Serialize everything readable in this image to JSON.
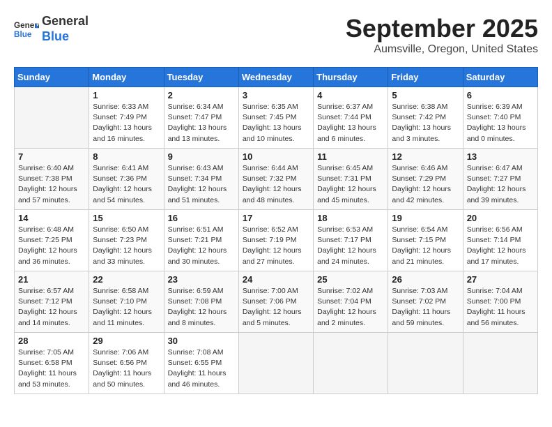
{
  "header": {
    "logo_general": "General",
    "logo_blue": "Blue",
    "month_title": "September 2025",
    "subtitle": "Aumsville, Oregon, United States"
  },
  "weekdays": [
    "Sunday",
    "Monday",
    "Tuesday",
    "Wednesday",
    "Thursday",
    "Friday",
    "Saturday"
  ],
  "weeks": [
    [
      {
        "num": "",
        "info": ""
      },
      {
        "num": "1",
        "info": "Sunrise: 6:33 AM\nSunset: 7:49 PM\nDaylight: 13 hours\nand 16 minutes."
      },
      {
        "num": "2",
        "info": "Sunrise: 6:34 AM\nSunset: 7:47 PM\nDaylight: 13 hours\nand 13 minutes."
      },
      {
        "num": "3",
        "info": "Sunrise: 6:35 AM\nSunset: 7:45 PM\nDaylight: 13 hours\nand 10 minutes."
      },
      {
        "num": "4",
        "info": "Sunrise: 6:37 AM\nSunset: 7:44 PM\nDaylight: 13 hours\nand 6 minutes."
      },
      {
        "num": "5",
        "info": "Sunrise: 6:38 AM\nSunset: 7:42 PM\nDaylight: 13 hours\nand 3 minutes."
      },
      {
        "num": "6",
        "info": "Sunrise: 6:39 AM\nSunset: 7:40 PM\nDaylight: 13 hours\nand 0 minutes."
      }
    ],
    [
      {
        "num": "7",
        "info": "Sunrise: 6:40 AM\nSunset: 7:38 PM\nDaylight: 12 hours\nand 57 minutes."
      },
      {
        "num": "8",
        "info": "Sunrise: 6:41 AM\nSunset: 7:36 PM\nDaylight: 12 hours\nand 54 minutes."
      },
      {
        "num": "9",
        "info": "Sunrise: 6:43 AM\nSunset: 7:34 PM\nDaylight: 12 hours\nand 51 minutes."
      },
      {
        "num": "10",
        "info": "Sunrise: 6:44 AM\nSunset: 7:32 PM\nDaylight: 12 hours\nand 48 minutes."
      },
      {
        "num": "11",
        "info": "Sunrise: 6:45 AM\nSunset: 7:31 PM\nDaylight: 12 hours\nand 45 minutes."
      },
      {
        "num": "12",
        "info": "Sunrise: 6:46 AM\nSunset: 7:29 PM\nDaylight: 12 hours\nand 42 minutes."
      },
      {
        "num": "13",
        "info": "Sunrise: 6:47 AM\nSunset: 7:27 PM\nDaylight: 12 hours\nand 39 minutes."
      }
    ],
    [
      {
        "num": "14",
        "info": "Sunrise: 6:48 AM\nSunset: 7:25 PM\nDaylight: 12 hours\nand 36 minutes."
      },
      {
        "num": "15",
        "info": "Sunrise: 6:50 AM\nSunset: 7:23 PM\nDaylight: 12 hours\nand 33 minutes."
      },
      {
        "num": "16",
        "info": "Sunrise: 6:51 AM\nSunset: 7:21 PM\nDaylight: 12 hours\nand 30 minutes."
      },
      {
        "num": "17",
        "info": "Sunrise: 6:52 AM\nSunset: 7:19 PM\nDaylight: 12 hours\nand 27 minutes."
      },
      {
        "num": "18",
        "info": "Sunrise: 6:53 AM\nSunset: 7:17 PM\nDaylight: 12 hours\nand 24 minutes."
      },
      {
        "num": "19",
        "info": "Sunrise: 6:54 AM\nSunset: 7:15 PM\nDaylight: 12 hours\nand 21 minutes."
      },
      {
        "num": "20",
        "info": "Sunrise: 6:56 AM\nSunset: 7:14 PM\nDaylight: 12 hours\nand 17 minutes."
      }
    ],
    [
      {
        "num": "21",
        "info": "Sunrise: 6:57 AM\nSunset: 7:12 PM\nDaylight: 12 hours\nand 14 minutes."
      },
      {
        "num": "22",
        "info": "Sunrise: 6:58 AM\nSunset: 7:10 PM\nDaylight: 12 hours\nand 11 minutes."
      },
      {
        "num": "23",
        "info": "Sunrise: 6:59 AM\nSunset: 7:08 PM\nDaylight: 12 hours\nand 8 minutes."
      },
      {
        "num": "24",
        "info": "Sunrise: 7:00 AM\nSunset: 7:06 PM\nDaylight: 12 hours\nand 5 minutes."
      },
      {
        "num": "25",
        "info": "Sunrise: 7:02 AM\nSunset: 7:04 PM\nDaylight: 12 hours\nand 2 minutes."
      },
      {
        "num": "26",
        "info": "Sunrise: 7:03 AM\nSunset: 7:02 PM\nDaylight: 11 hours\nand 59 minutes."
      },
      {
        "num": "27",
        "info": "Sunrise: 7:04 AM\nSunset: 7:00 PM\nDaylight: 11 hours\nand 56 minutes."
      }
    ],
    [
      {
        "num": "28",
        "info": "Sunrise: 7:05 AM\nSunset: 6:58 PM\nDaylight: 11 hours\nand 53 minutes."
      },
      {
        "num": "29",
        "info": "Sunrise: 7:06 AM\nSunset: 6:56 PM\nDaylight: 11 hours\nand 50 minutes."
      },
      {
        "num": "30",
        "info": "Sunrise: 7:08 AM\nSunset: 6:55 PM\nDaylight: 11 hours\nand 46 minutes."
      },
      {
        "num": "",
        "info": ""
      },
      {
        "num": "",
        "info": ""
      },
      {
        "num": "",
        "info": ""
      },
      {
        "num": "",
        "info": ""
      }
    ]
  ]
}
